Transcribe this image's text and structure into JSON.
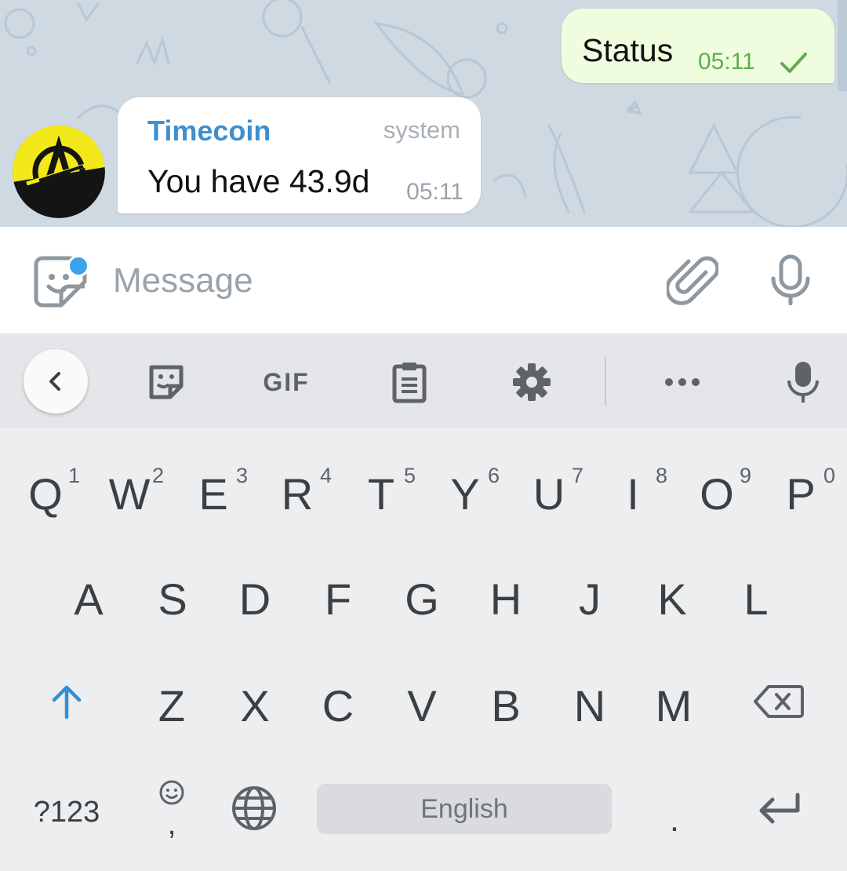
{
  "chat": {
    "outgoing": {
      "text": "Status",
      "time": "05:11"
    },
    "incoming": {
      "sender": "Timecoin",
      "tag": "system",
      "text": "You have 43.9d",
      "time": "05:11"
    }
  },
  "composer": {
    "placeholder": "Message"
  },
  "keyboard": {
    "toolbar": {
      "gif_label": "GIF"
    },
    "row1": [
      {
        "k": "Q",
        "n": "1"
      },
      {
        "k": "W",
        "n": "2"
      },
      {
        "k": "E",
        "n": "3"
      },
      {
        "k": "R",
        "n": "4"
      },
      {
        "k": "T",
        "n": "5"
      },
      {
        "k": "Y",
        "n": "6"
      },
      {
        "k": "U",
        "n": "7"
      },
      {
        "k": "I",
        "n": "8"
      },
      {
        "k": "O",
        "n": "9"
      },
      {
        "k": "P",
        "n": "0"
      }
    ],
    "row2": [
      "A",
      "S",
      "D",
      "F",
      "G",
      "H",
      "J",
      "K",
      "L"
    ],
    "row3": [
      "Z",
      "X",
      "C",
      "V",
      "B",
      "N",
      "M"
    ],
    "symbols_label": "?123",
    "comma": ",",
    "period": ".",
    "space_label": "English"
  },
  "colors": {
    "accent": "#3ea1ec",
    "sender": "#3f8fcd",
    "sent_bubble": "#effdde",
    "check": "#5fae4e"
  }
}
